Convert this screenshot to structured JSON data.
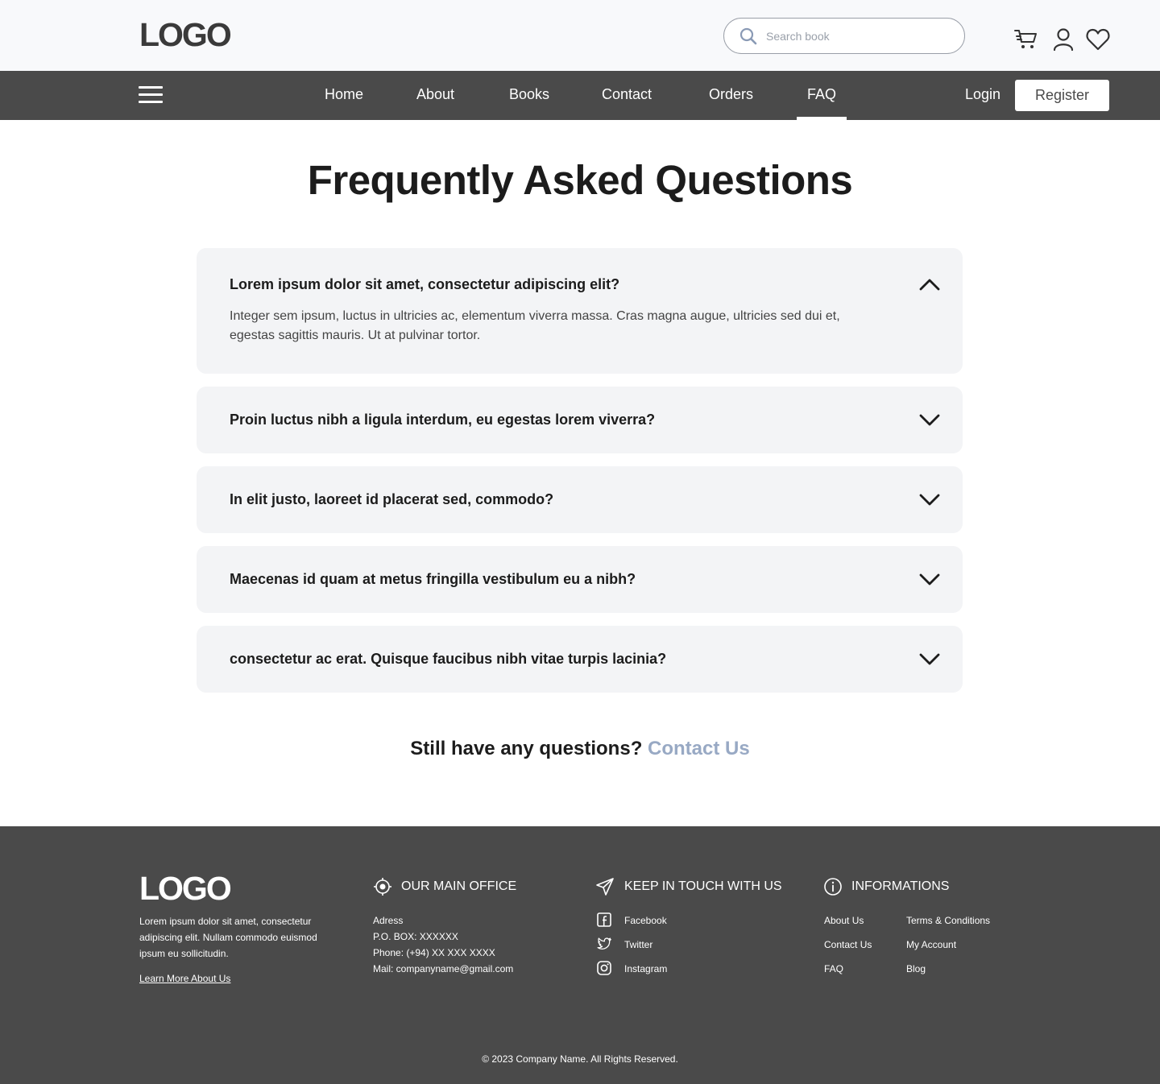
{
  "header": {
    "logo": "LOGO",
    "search_placeholder": "Search book"
  },
  "nav": {
    "items": [
      "Home",
      "About",
      "Books",
      "Contact",
      "Orders",
      "FAQ"
    ],
    "active": "FAQ",
    "login": "Login",
    "register": "Register"
  },
  "main": {
    "title": "Frequently Asked Questions",
    "faqs": [
      {
        "question": "Lorem ipsum dolor sit amet, consectetur adipiscing elit?",
        "answer": "Integer sem ipsum, luctus in ultricies ac, elementum viverra massa. Cras magna augue, ultricies sed dui et, egestas sagittis mauris. Ut at pulvinar tortor.",
        "expanded": true
      },
      {
        "question": "Proin luctus nibh a ligula interdum, eu egestas lorem viverra?",
        "expanded": false
      },
      {
        "question": "In elit justo, laoreet id placerat sed, commodo?",
        "expanded": false
      },
      {
        "question": "Maecenas id quam at metus fringilla vestibulum eu a nibh?",
        "expanded": false
      },
      {
        "question": "consectetur ac erat. Quisque faucibus nibh vitae turpis lacinia?",
        "expanded": false
      }
    ],
    "still_text": "Still have any questions?",
    "contact_link": "Contact Us"
  },
  "footer": {
    "logo": "LOGO",
    "about": "Lorem ipsum dolor sit amet, consectetur adipiscing elit. Nullam commodo euismod ipsum eu sollicitudin.",
    "learn_more": "Learn More About Us",
    "office": {
      "heading": "OUR MAIN OFFICE",
      "lines": [
        "Adress",
        "P.O. BOX: XXXXXX",
        "Phone: (+94) XX XXX XXXX",
        "Mail: companyname@gmail.com"
      ]
    },
    "social": {
      "heading": "KEEP IN TOUCH WITH US",
      "links": [
        "Facebook",
        "Twitter",
        "Instagram"
      ]
    },
    "info": {
      "heading": "INFORMATIONS",
      "col1": [
        "About Us",
        "Contact Us",
        "FAQ"
      ],
      "col2": [
        "Terms & Conditions",
        "My Account",
        "Blog"
      ]
    },
    "copyright": "© 2023 Company Name. All Rights Reserved."
  },
  "colors": {
    "nav_bg": "#4a4a4a",
    "header_bg": "#f8f9fb",
    "card_bg": "#f3f4f6",
    "link_accent": "#98a9c4"
  }
}
